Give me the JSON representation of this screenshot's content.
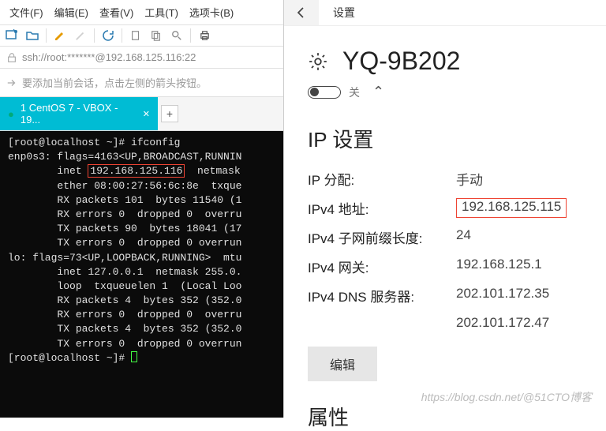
{
  "left": {
    "menu": [
      "文件(F)",
      "编辑(E)",
      "查看(V)",
      "工具(T)",
      "选项卡(B)"
    ],
    "address": "ssh://root:*******@192.168.125.116:22",
    "hint": "要添加当前会话，点击左侧的箭头按钮。",
    "tab": {
      "label": "1 CentOS 7 - VBOX - 19..."
    },
    "terminal": {
      "lines": [
        "[root@localhost ~]# ifconfig",
        "enp0s3: flags=4163<UP,BROADCAST,RUNNIN",
        "        inet |192.168.125.116|  netmask",
        "        ether 08:00:27:56:6c:8e  txque",
        "        RX packets 101  bytes 11540 (1",
        "        RX errors 0  dropped 0  overru",
        "        TX packets 90  bytes 18041 (17",
        "        TX errors 0  dropped 0 overrun",
        "",
        "lo: flags=73<UP,LOOPBACK,RUNNING>  mtu",
        "        inet 127.0.0.1  netmask 255.0.",
        "        loop  txqueuelen 1  (Local Loo",
        "        RX packets 4  bytes 352 (352.0",
        "        RX errors 0  dropped 0  overru",
        "        TX packets 4  bytes 352 (352.0",
        "        TX errors 0  dropped 0 overrun",
        "",
        "[root@localhost ~]# "
      ]
    }
  },
  "right": {
    "header": "设置",
    "title": "YQ-9B202",
    "toggle_label": "关",
    "ip_section": {
      "heading": "IP 设置",
      "rows": [
        {
          "k": "IP 分配:",
          "v": "手动",
          "hl": false
        },
        {
          "k": "IPv4 地址:",
          "v": "192.168.125.115",
          "hl": true
        },
        {
          "k": "IPv4 子网前缀长度:",
          "v": "24",
          "hl": false
        },
        {
          "k": "IPv4 网关:",
          "v": "192.168.125.1",
          "hl": false
        },
        {
          "k": "IPv4 DNS 服务器:",
          "v": "202.101.172.35",
          "hl": false
        },
        {
          "k": "",
          "v": "202.101.172.47",
          "hl": false
        }
      ],
      "edit": "编辑"
    },
    "attributes_heading": "属性",
    "watermark": "https://blog.csdn.net/@51CTO博客"
  }
}
